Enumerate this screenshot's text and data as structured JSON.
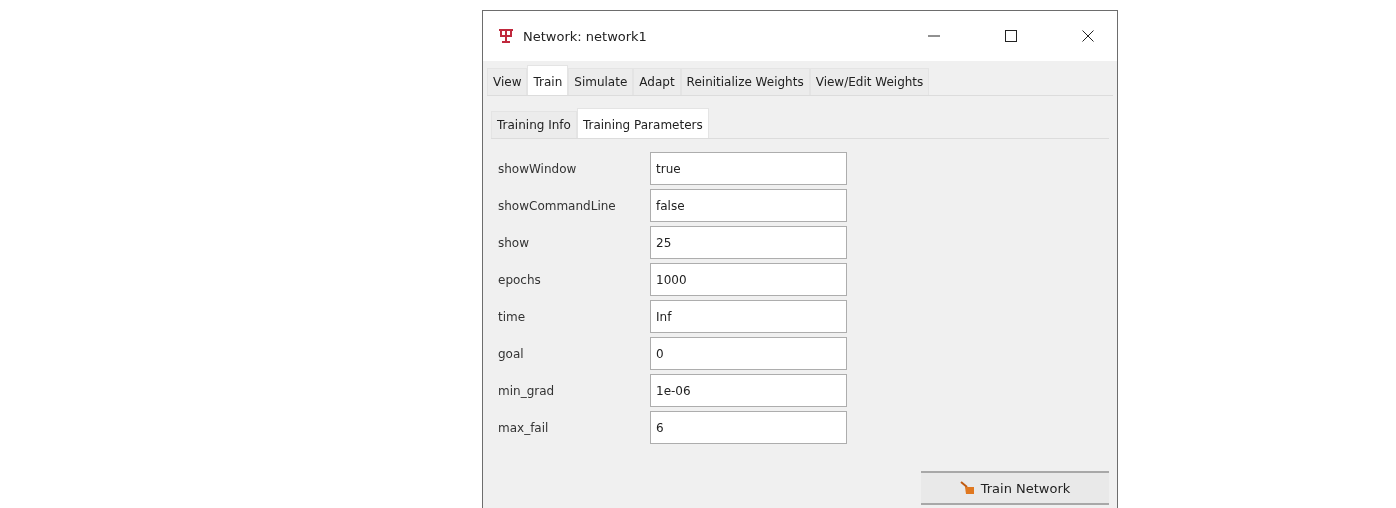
{
  "window": {
    "title": "Network: network1"
  },
  "tabs": [
    {
      "label": "View",
      "selected": false
    },
    {
      "label": "Train",
      "selected": true
    },
    {
      "label": "Simulate",
      "selected": false
    },
    {
      "label": "Adapt",
      "selected": false
    },
    {
      "label": "Reinitialize Weights",
      "selected": false
    },
    {
      "label": "View/Edit Weights",
      "selected": false
    }
  ],
  "subtabs": [
    {
      "label": "Training Info",
      "selected": false
    },
    {
      "label": "Training Parameters",
      "selected": true
    }
  ],
  "parameters": [
    {
      "name": "showWindow",
      "value": "true"
    },
    {
      "name": "showCommandLine",
      "value": "false"
    },
    {
      "name": "show",
      "value": "25"
    },
    {
      "name": "epochs",
      "value": "1000"
    },
    {
      "name": "time",
      "value": "Inf"
    },
    {
      "name": "goal",
      "value": "0"
    },
    {
      "name": "min_grad",
      "value": "1e-06"
    },
    {
      "name": "max_fail",
      "value": "6"
    }
  ],
  "train_button": "Train Network"
}
